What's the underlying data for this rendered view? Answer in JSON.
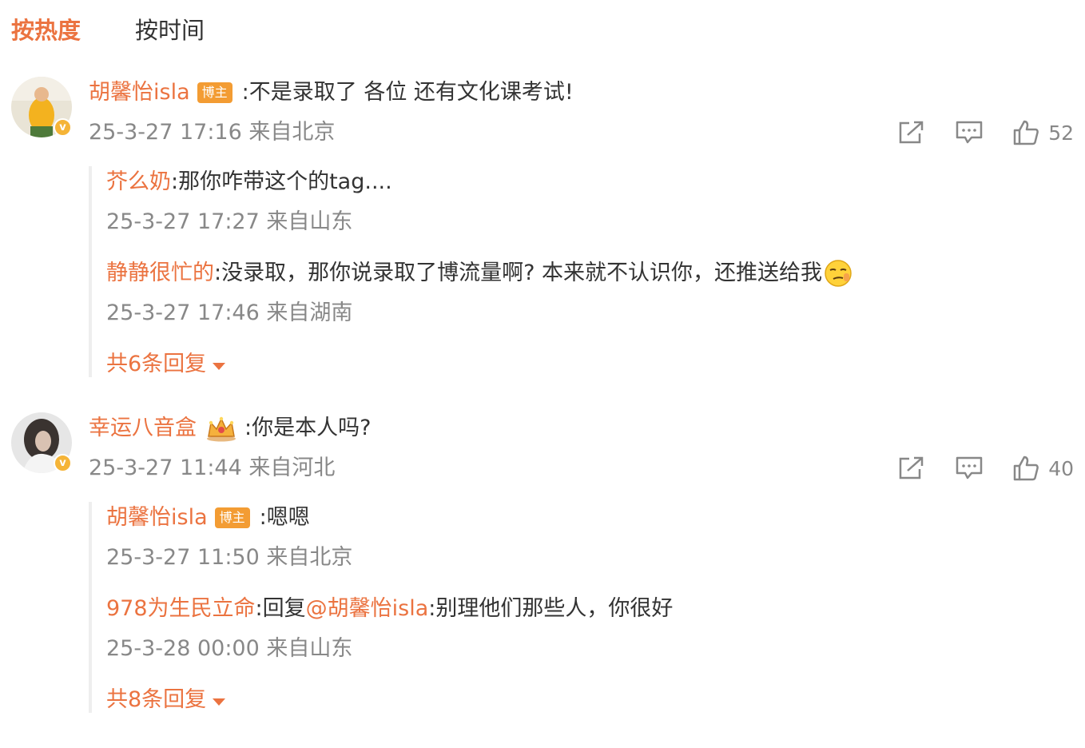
{
  "sort": {
    "hot": "按热度",
    "time": "按时间"
  },
  "colors": {
    "accent": "#eb7340",
    "text": "#333333",
    "meta": "#888888",
    "badge": "#f39c33"
  },
  "comments": [
    {
      "user": "胡馨怡isla",
      "badge": "博主",
      "text": ":不是录取了 各位 还有文化课考试!",
      "meta": "25-3-27 17:16 来自北京",
      "likes": "52",
      "verified": "v",
      "replies": [
        {
          "user": "芥么奶",
          "text": ":那你咋带这个的tag....",
          "meta": "25-3-27 17:27 来自山东"
        },
        {
          "user": "静静很忙的",
          "text": ":没录取，那你说录取了博流量啊? 本来就不认识你，还推送给我",
          "emoji": "smirk-emoji",
          "meta": "25-3-27 17:46 来自湖南"
        }
      ],
      "more": "共6条回复"
    },
    {
      "user": "幸运八音盒",
      "badge_icon": "crown-icon",
      "text": ":你是本人吗?",
      "meta": "25-3-27 11:44 来自河北",
      "likes": "40",
      "verified": "v",
      "replies": [
        {
          "user": "胡馨怡isla",
          "badge": "博主",
          "text": ":嗯嗯",
          "meta": "25-3-27 11:50 来自北京"
        },
        {
          "user": "978为生民立命",
          "text_prefix": ":回复",
          "mention": "@胡馨怡isla",
          "text": ":别理他们那些人，你很好",
          "meta": "25-3-28 00:00 来自山东"
        }
      ],
      "more": "共8条回复"
    }
  ]
}
